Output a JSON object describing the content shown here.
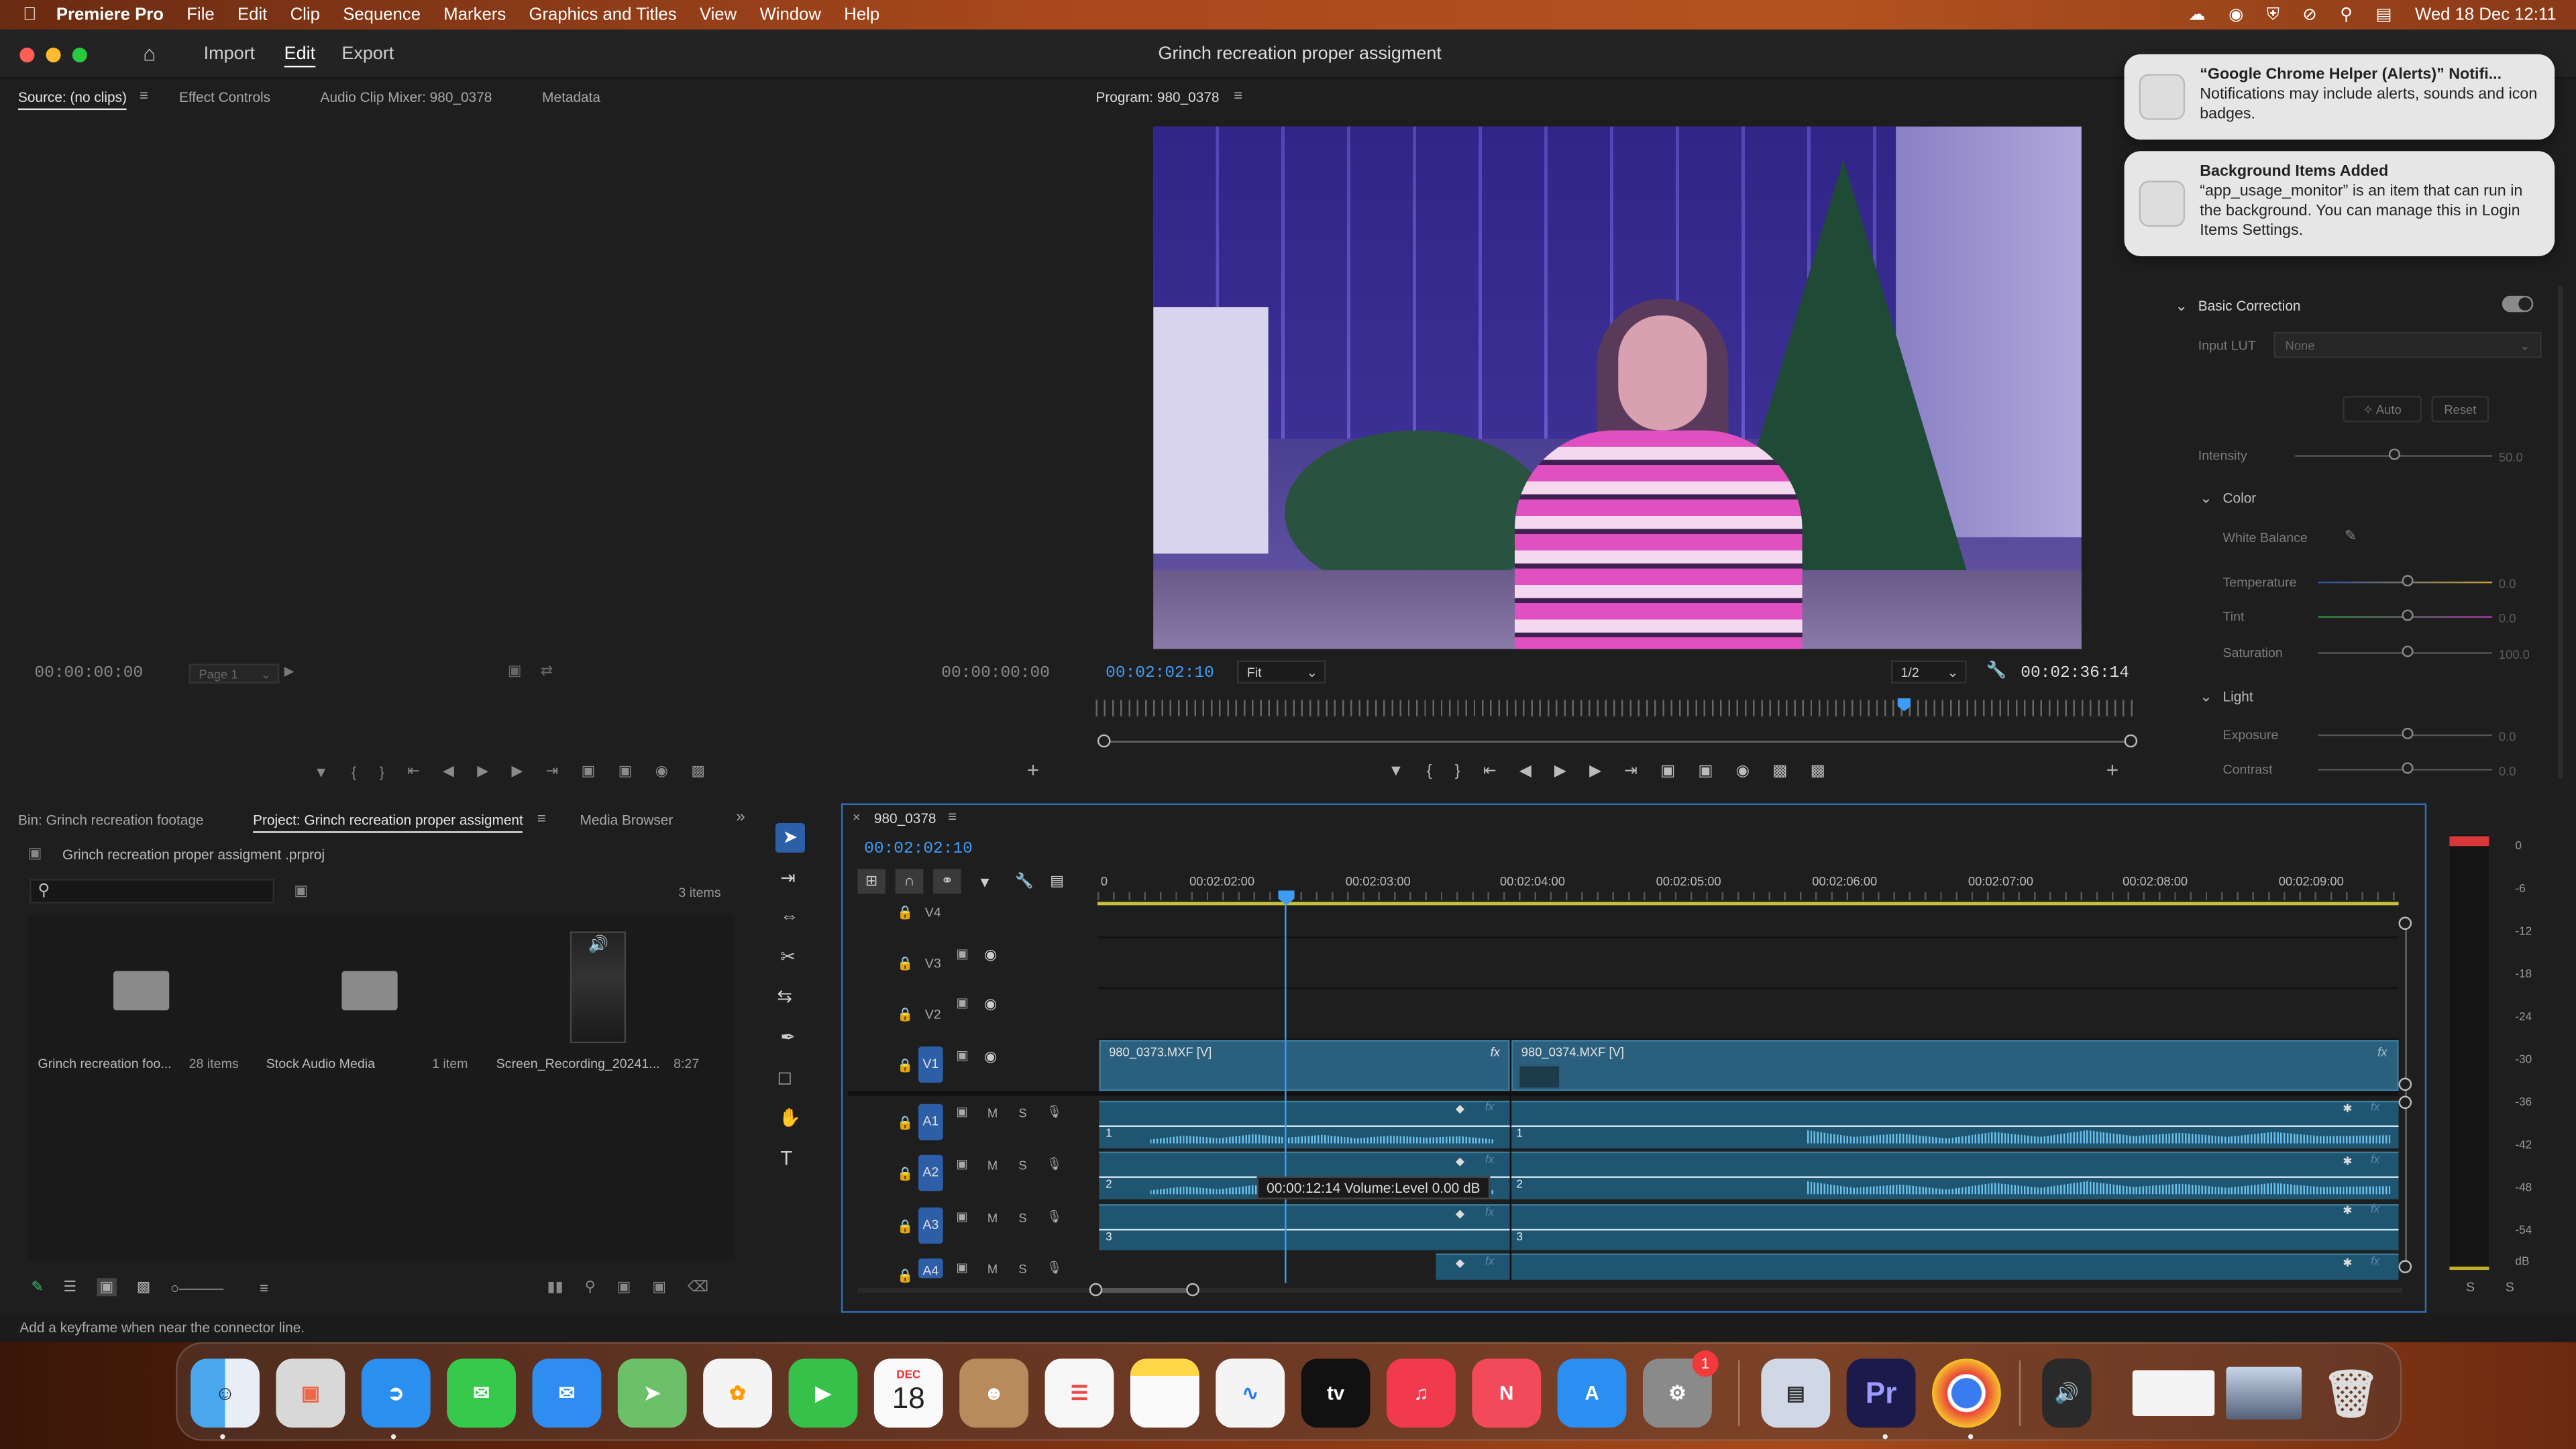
{
  "menubar": {
    "app": "Premiere Pro",
    "items": [
      "File",
      "Edit",
      "Clip",
      "Sequence",
      "Markers",
      "Graphics and Titles",
      "View",
      "Window",
      "Help"
    ],
    "datetime": "Wed 18 Dec  12:11"
  },
  "header": {
    "tabs": [
      "Import",
      "Edit",
      "Export"
    ],
    "active_tab": "Edit",
    "title": "Grinch recreation proper  assigment"
  },
  "source_panel": {
    "tabs": [
      "Source: (no clips)",
      "Effect Controls",
      "Audio Clip Mixer: 980_0378",
      "Metadata"
    ],
    "timecode_left": "00:00:00:00",
    "page": "Page 1",
    "timecode_right": "00:00:00:00"
  },
  "program_panel": {
    "tab": "Program: 980_0378",
    "timecode": "00:02:02:10",
    "fit": "Fit",
    "resolution": "1/2",
    "duration": "00:02:36:14"
  },
  "lumetri": {
    "basic_correction": "Basic Correction",
    "input_lut_label": "Input LUT",
    "input_lut_value": "None",
    "auto": "Auto",
    "reset": "Reset",
    "intensity_label": "Intensity",
    "intensity_value": "50.0",
    "color_heading": "Color",
    "white_balance": "White Balance",
    "temperature_label": "Temperature",
    "temperature_value": "0.0",
    "tint_label": "Tint",
    "tint_value": "0.0",
    "saturation_label": "Saturation",
    "saturation_value": "100.0",
    "light_heading": "Light",
    "exposure_label": "Exposure",
    "exposure_value": "0.0",
    "contrast_label": "Contrast",
    "contrast_value": "0.0"
  },
  "notifications": [
    {
      "title": "“Google Chrome Helper (Alerts)” Notifi...",
      "body": "Notifications may include alerts, sounds and icon badges."
    },
    {
      "title": "Background Items Added",
      "body": "“app_usage_monitor” is an item that can run in the background. You can manage this in Login Items Settings."
    }
  ],
  "project_panel": {
    "tabs": [
      "Bin: Grinch recreation footage",
      "Project: Grinch recreation proper  assigment",
      "Media Browser"
    ],
    "project_file": "Grinch recreation proper  assigment .prproj",
    "item_count": "3 items",
    "items": [
      {
        "name": "Grinch recreation foo...",
        "meta": "28 items"
      },
      {
        "name": "Stock Audio Media",
        "meta": "1 item"
      },
      {
        "name": "Screen_Recording_20241...",
        "meta": "8:27"
      }
    ]
  },
  "timeline": {
    "sequence": "980_0378",
    "timecode": "00:02:02:10",
    "ruler": [
      "0",
      "00:02:02:00",
      "00:02:03:00",
      "00:02:04:00",
      "00:02:05:00",
      "00:02:06:00",
      "00:02:07:00",
      "00:02:08:00",
      "00:02:09:00"
    ],
    "video_tracks": [
      "V4",
      "V3",
      "V2",
      "V1"
    ],
    "audio_tracks": [
      "A1",
      "A2",
      "A3",
      "A4"
    ],
    "clip1": "980_0373.MXF [V]",
    "clip2": "980_0374.MXF [V]",
    "tooltip": "00:00:12:14  Volume:Level  0.00 dB",
    "track_m": "M",
    "track_s": "S",
    "fx": "fx",
    "num1": "1",
    "num2": "2",
    "num3": "3"
  },
  "meter_scale": [
    "0",
    "-6",
    "-12",
    "-18",
    "-24",
    "-30",
    "-36",
    "-42",
    "-48",
    "-54",
    "dB"
  ],
  "meter_solo": [
    "S",
    "S"
  ],
  "status_bar": "Add a keyframe when near the connector line.",
  "dock": {
    "calendar_month": "DEC",
    "calendar_day": "18",
    "settings_badge": "1",
    "premiere_label": "Pr",
    "tv_label": "tv"
  }
}
